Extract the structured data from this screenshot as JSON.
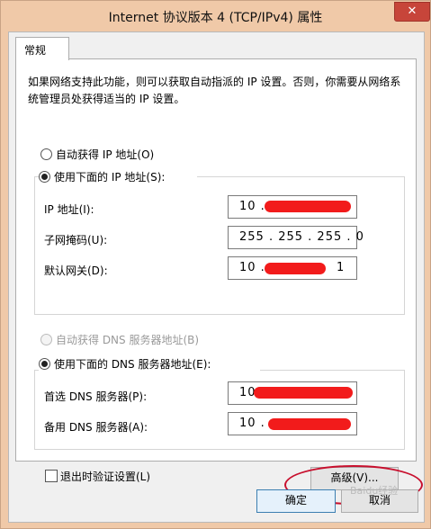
{
  "window": {
    "title": "Internet 协议版本 4 (TCP/IPv4) 属性",
    "close_symbol": "✕"
  },
  "tab": {
    "label": "常规"
  },
  "description": "如果网络支持此功能，则可以获取自动指派的 IP 设置。否则，你需要从网络系统管理员处获得适当的 IP 设置。",
  "ip": {
    "auto_label": "自动获得 IP 地址(O)",
    "manual_label": "使用下面的 IP 地址(S):",
    "selected": "manual",
    "address": {
      "label": "IP 地址(I):",
      "prefix": "10 ."
    },
    "subnet": {
      "label": "子网掩码(U):",
      "value": "255 . 255 . 255 . 0"
    },
    "gateway": {
      "label": "默认网关(D):",
      "prefix": "10 .",
      "suffix": "1"
    }
  },
  "dns": {
    "auto_label": "自动获得 DNS 服务器地址(B)",
    "manual_label": "使用下面的 DNS 服务器地址(E):",
    "selected": "manual",
    "preferred": {
      "label": "首选 DNS 服务器(P):",
      "prefix": "10"
    },
    "alternate": {
      "label": "备用 DNS 服务器(A):",
      "prefix": "10 ."
    }
  },
  "validate": {
    "label": "退出时验证设置(L)",
    "checked": false
  },
  "buttons": {
    "advanced": "高级(V)...",
    "ok": "确定",
    "cancel": "取消"
  },
  "watermark": "Baidu经验",
  "colors": {
    "title_background": "#f0c9a8",
    "redaction": "#f21b1b",
    "annotation": "#c8102e"
  }
}
